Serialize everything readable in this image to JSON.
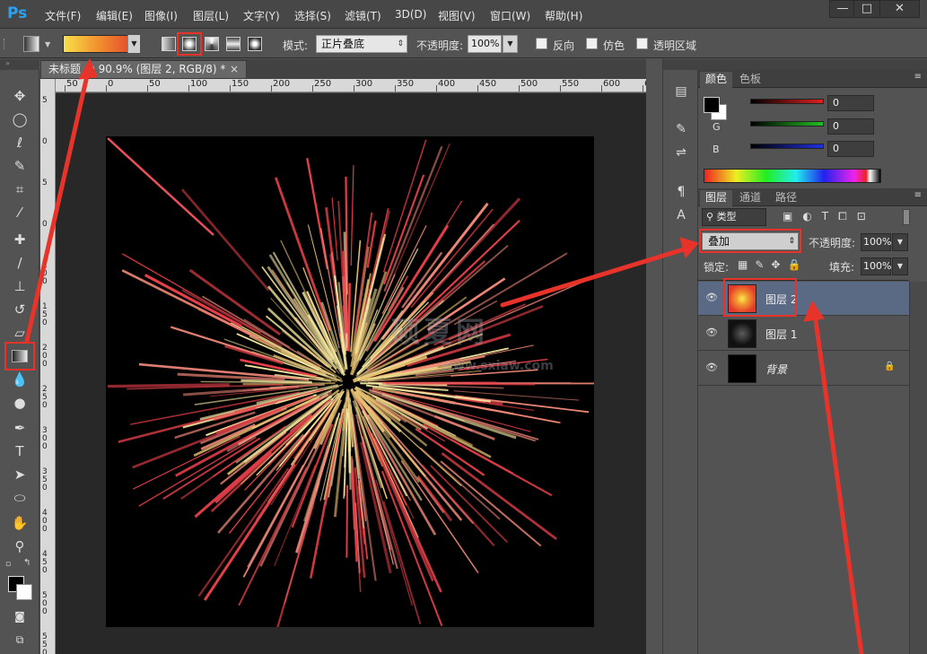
{
  "app": {
    "logo": "Ps"
  },
  "menu": [
    "文件(F)",
    "编辑(E)",
    "图像(I)",
    "图层(L)",
    "文字(Y)",
    "选择(S)",
    "滤镜(T)",
    "3D(D)",
    "视图(V)",
    "窗口(W)",
    "帮助(H)"
  ],
  "window_controls": {
    "minimize": "—",
    "maximize": "□",
    "close": "✕"
  },
  "options": {
    "mode_label": "模式:",
    "mode_value": "正片叠底",
    "opacity_label": "不透明度:",
    "opacity_value": "100%",
    "reverse_label": "反向",
    "dither_label": "仿色",
    "transparency_label": "透明区域"
  },
  "document": {
    "tab_title": "未标题 @ 90.9% (图层 2, RGB/8) *",
    "close": "×",
    "ruler_h": [
      "50",
      "0",
      "50",
      "100",
      "150",
      "200",
      "250",
      "300",
      "350",
      "400",
      "450",
      "500",
      "550",
      "600",
      "6"
    ],
    "ruler_v": [
      "5",
      "0",
      "5",
      "0",
      "1 0 0",
      "1 5 0",
      "2 0 0",
      "2 5 0",
      "3 0 0",
      "3 5 0",
      "4 0 0",
      "4 5 0",
      "5 0 0",
      "5 5 0"
    ],
    "watermark": "硕夏网",
    "watermark_url": "www.sxiaw.com"
  },
  "color_panel": {
    "tabs": [
      "颜色",
      "色板"
    ],
    "channels": [
      {
        "label": "R",
        "value": "0",
        "color": "#e02020"
      },
      {
        "label": "G",
        "value": "0",
        "color": "#20c020"
      },
      {
        "label": "B",
        "value": "0",
        "color": "#2030e0"
      }
    ]
  },
  "layers_panel": {
    "tabs": [
      "图层",
      "通道",
      "路径"
    ],
    "filter_kind": "类型",
    "blend_mode": "叠加",
    "opacity_label": "不透明度:",
    "opacity_value": "100%",
    "lock_label": "锁定:",
    "fill_label": "填充:",
    "fill_value": "100%",
    "layers": [
      {
        "name": "图层 2",
        "selected": true
      },
      {
        "name": "图层 1",
        "selected": false
      },
      {
        "name": "背景",
        "selected": false
      }
    ]
  },
  "colors": {
    "highlight": "#e8332a",
    "selected_layer": "#5a6a85"
  }
}
